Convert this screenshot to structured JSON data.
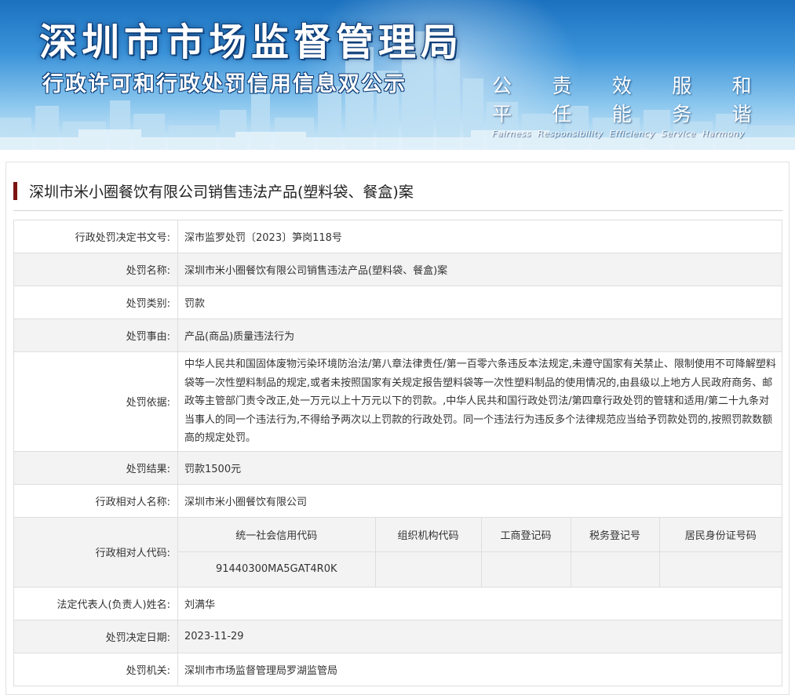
{
  "banner": {
    "title": "深圳市市场监督管理局",
    "subtitle": "行政许可和行政处罚信用信息双公示",
    "motto_cn": [
      "公平",
      "责任",
      "效能",
      "服务",
      "和谐"
    ],
    "motto_en": [
      "Fairness",
      "Responsibility",
      "Efficiency",
      "Service",
      "Harmony"
    ]
  },
  "case": {
    "title": "深圳市米小圈餐饮有限公司销售违法产品(塑料袋、餐盒)案"
  },
  "rows": {
    "decision_no": {
      "label": "行政处罚决定书文号:",
      "value": "深市监罗处罚〔2023〕笋岗118号"
    },
    "penalty_name": {
      "label": "处罚名称:",
      "value": "深圳市米小圈餐饮有限公司销售违法产品(塑料袋、餐盒)案"
    },
    "penalty_type": {
      "label": "处罚类别:",
      "value": "罚款"
    },
    "penalty_reason": {
      "label": "处罚事由:",
      "value": "产品(商品)质量违法行为"
    },
    "penalty_basis": {
      "label": "处罚依据:",
      "value": "中华人民共和国固体废物污染环境防治法/第八章法律责任/第一百零六条违反本法规定,未遵守国家有关禁止、限制使用不可降解塑料袋等一次性塑料制品的规定,或者未按照国家有关规定报告塑料袋等一次性塑料制品的使用情况的,由县级以上地方人民政府商务、邮政等主管部门责令改正,处一万元以上十万元以下的罚款。,中华人民共和国行政处罚法/第四章行政处罚的管辖和适用/第二十九条对当事人的同一个违法行为,不得给予两次以上罚款的行政处罚。同一个违法行为违反多个法律规范应当给予罚款处罚的,按照罚款数额高的规定处罚。"
    },
    "penalty_result": {
      "label": "处罚结果:",
      "value": "罚款1500元"
    },
    "counterparty_name": {
      "label": "行政相对人名称:",
      "value": "深圳市米小圈餐饮有限公司"
    },
    "counterparty_code": {
      "label": "行政相对人代码:",
      "headers": [
        "统一社会信用代码",
        "组织机构代码",
        "工商登记码",
        "税务登记号",
        "居民身份证号码"
      ],
      "values": [
        "91440300MA5GAT4R0K",
        "",
        "",
        "",
        ""
      ]
    },
    "legal_rep": {
      "label": "法定代表人(负责人)姓名:",
      "value": "刘满华"
    },
    "decision_date": {
      "label": "处罚决定日期:",
      "value": "2023-11-29"
    },
    "authority": {
      "label": "处罚机关:",
      "value": "深圳市市场监督管理局罗湖监管局"
    }
  }
}
